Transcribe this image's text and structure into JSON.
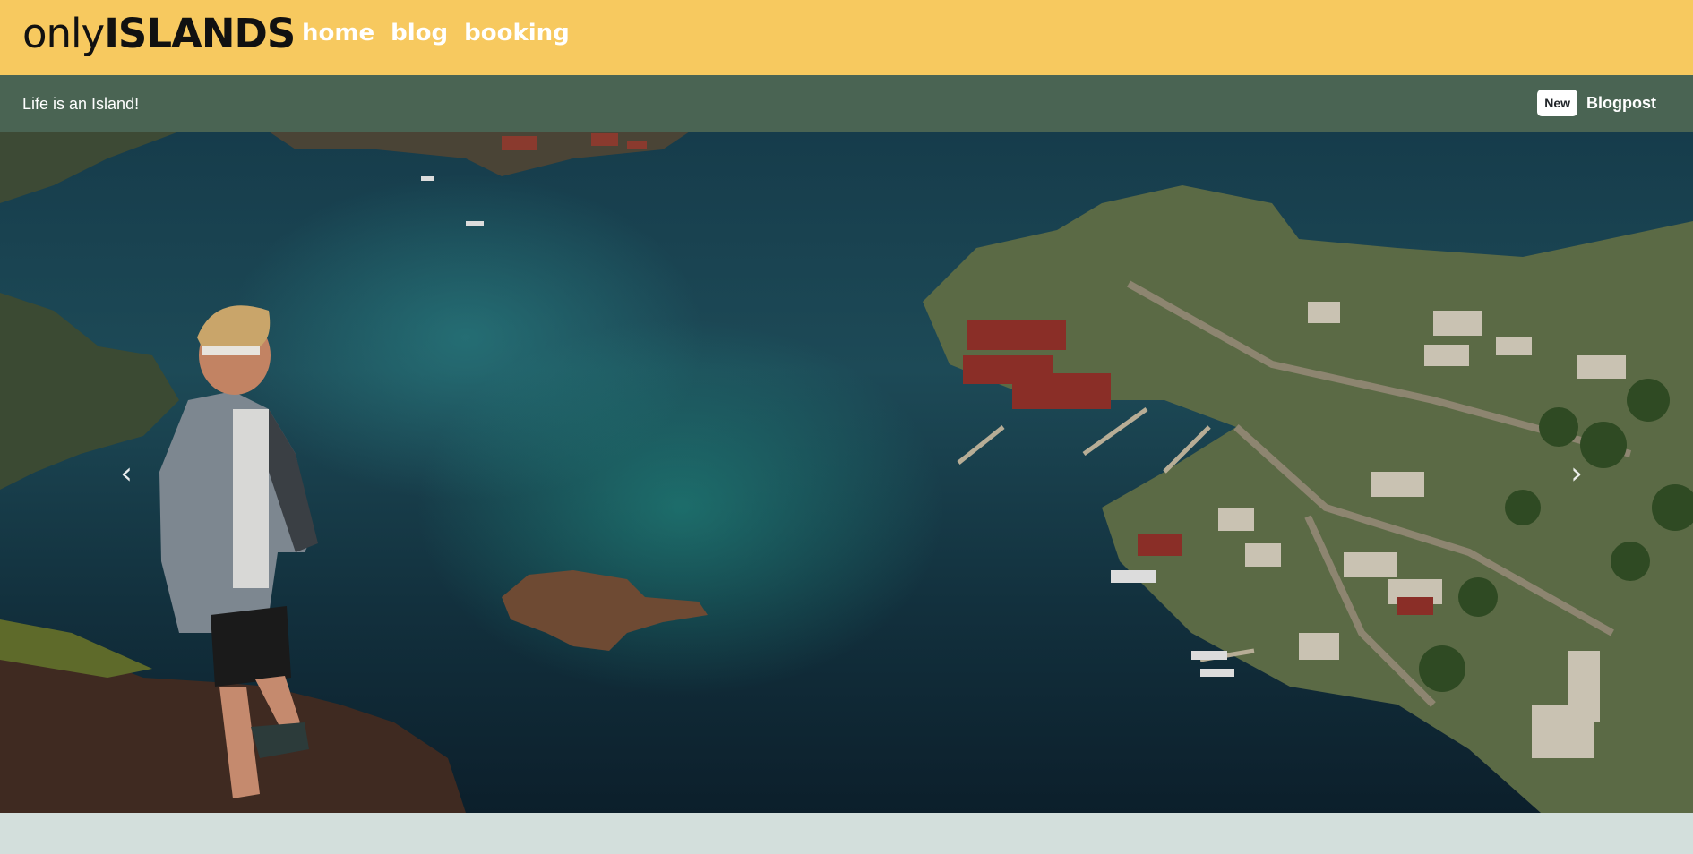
{
  "brand": {
    "light": "only",
    "bold": "ISLANDS"
  },
  "nav": {
    "home": "home",
    "blog": "blog",
    "booking": "booking"
  },
  "subbar": {
    "tagline": "Life is an Island!",
    "badge": "New",
    "post_label": "Blogpost"
  },
  "hero": {
    "image_alt": "Aerial view of a harbor town with a person standing on a cliff",
    "prev_icon": "chevron-left-icon",
    "next_icon": "chevron-right-icon"
  },
  "colors": {
    "header_bg": "#f7c95f",
    "subbar_bg": "#4a6453",
    "page_bg": "#d3dfdc",
    "nav_text": "#ffffff"
  }
}
